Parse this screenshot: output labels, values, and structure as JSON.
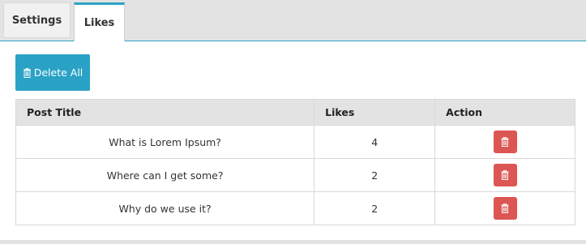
{
  "tabs": [
    {
      "label": "Settings"
    },
    {
      "label": "Likes"
    }
  ],
  "toolbar": {
    "delete_all_label": "Delete All"
  },
  "table": {
    "headers": {
      "title": "Post Title",
      "likes": "Likes",
      "action": "Action"
    },
    "rows": [
      {
        "title": "What is Lorem Ipsum?",
        "likes": "4"
      },
      {
        "title": "Where can I get some?",
        "likes": "2"
      },
      {
        "title": "Why do we use it?",
        "likes": "2"
      }
    ]
  },
  "colors": {
    "accent": "#29a2c6",
    "danger": "#dc5653",
    "header_bg": "#e3e3e3"
  },
  "icons": {
    "delete_all": "trash-icon",
    "row_delete": "trash-icon"
  }
}
